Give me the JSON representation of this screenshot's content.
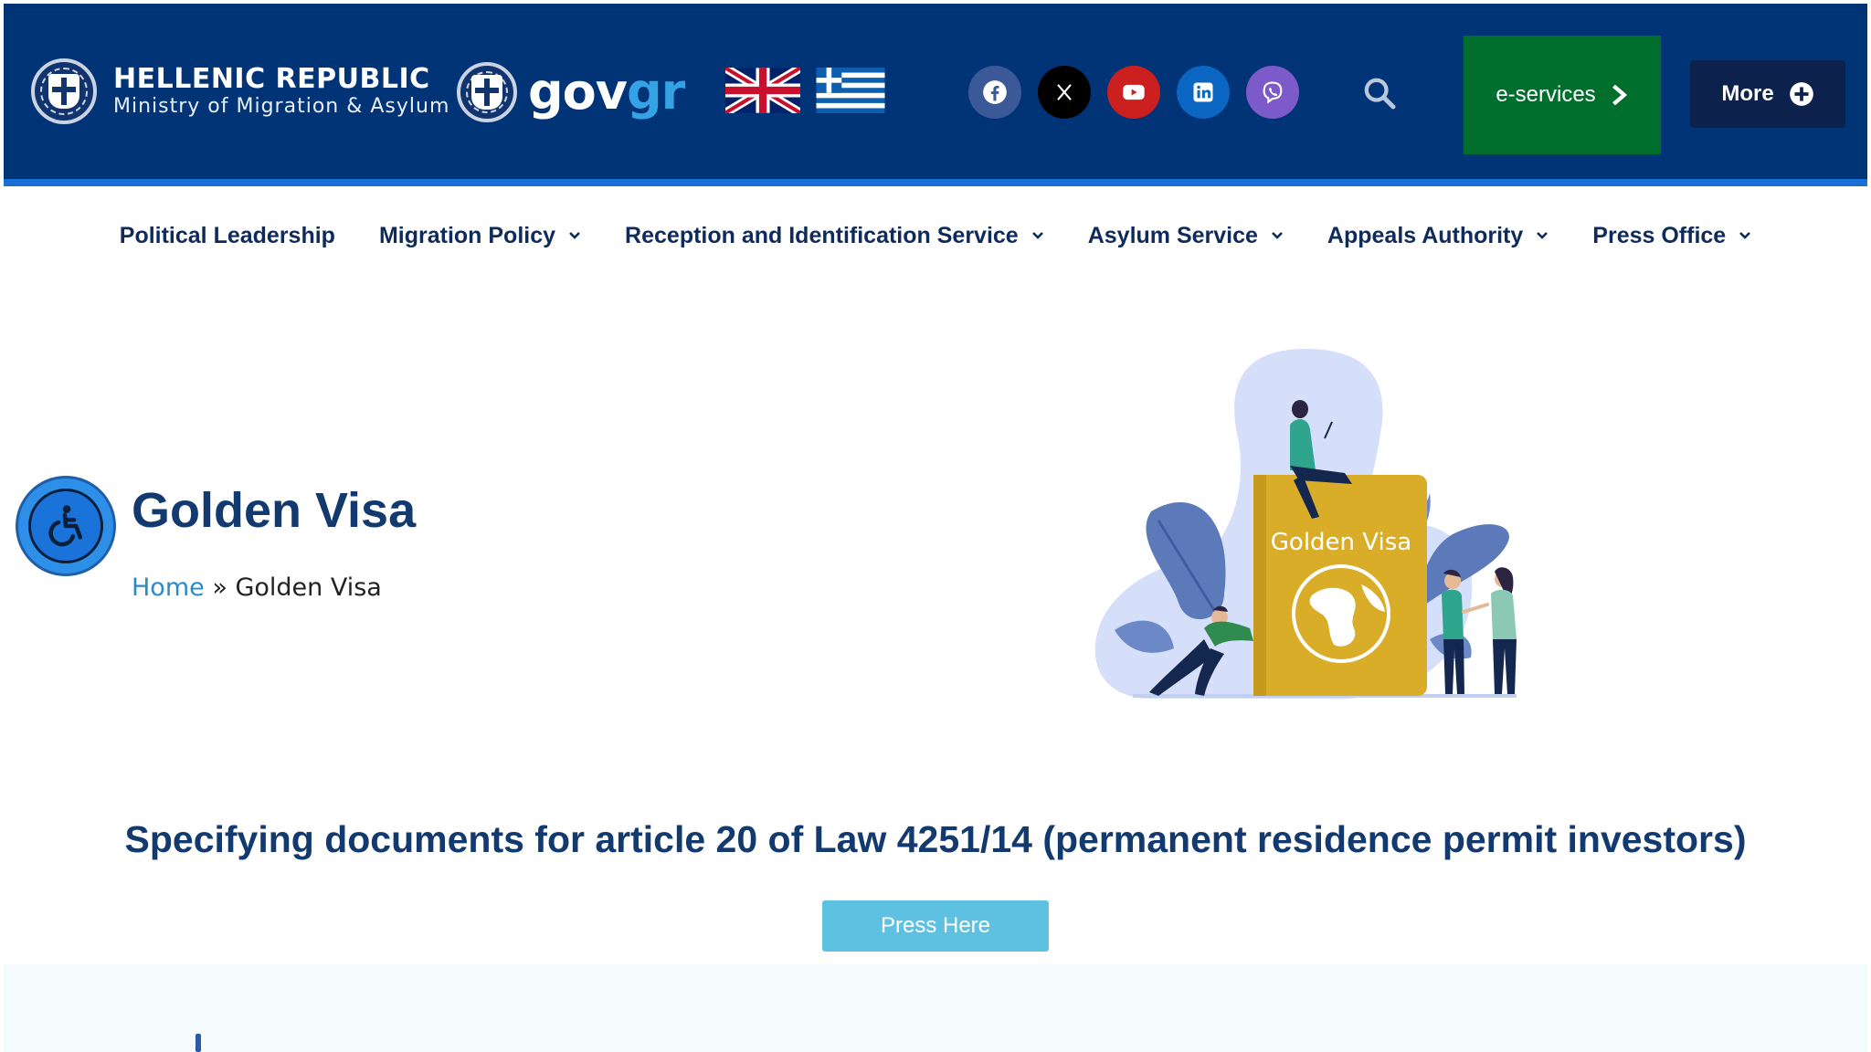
{
  "header": {
    "brand_title": "HELLENIC REPUBLIC",
    "brand_subtitle": "Ministry of Migration & Asylum",
    "gov_text_main": "gov",
    "gov_text_accent": "gr",
    "eservices_label": "e-services",
    "more_label": "More",
    "flags": [
      "united-kingdom-flag",
      "greece-flag"
    ],
    "socials": [
      {
        "icon": "facebook-icon",
        "color": "#3b5998"
      },
      {
        "icon": "x-icon",
        "color": "#000000"
      },
      {
        "icon": "youtube-icon",
        "color": "#cc1f1f"
      },
      {
        "icon": "linkedin-icon",
        "color": "#0a66c2"
      },
      {
        "icon": "viber-icon",
        "color": "#7d5ac9"
      }
    ],
    "colors": {
      "bar": "#003476",
      "stripe": "#1a6fd6",
      "eservices": "#006f2e",
      "more": "#0c224d"
    }
  },
  "nav": {
    "items": [
      {
        "label": "Political Leadership",
        "has_menu": false
      },
      {
        "label": "Migration Policy",
        "has_menu": true
      },
      {
        "label": "Reception and Identification Service",
        "has_menu": true
      },
      {
        "label": "Asylum Service",
        "has_menu": true
      },
      {
        "label": "Appeals Authority",
        "has_menu": true
      },
      {
        "label": "Press Office",
        "has_menu": true
      }
    ]
  },
  "hero": {
    "title": "Golden Visa",
    "breadcrumb_home": "Home",
    "breadcrumb_separator": "»",
    "breadcrumb_current": "Golden Visa",
    "illustration_label": "Golden Visa"
  },
  "section": {
    "title": "Specifying documents for article 20 of Law 4251/14 (permanent residence permit investors)",
    "button_label": "Press Here"
  }
}
